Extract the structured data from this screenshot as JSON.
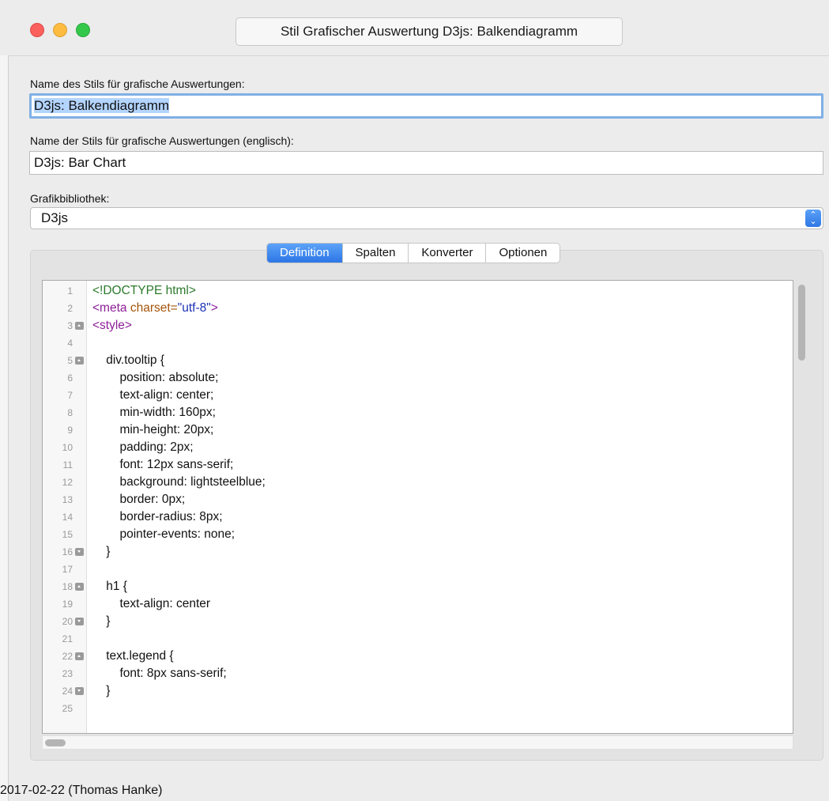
{
  "window": {
    "title": "Stil Grafischer Auswertung D3js: Balkendiagramm"
  },
  "form": {
    "name_label": "Name des Stils für grafische Auswertungen:",
    "name_value": "D3js: Balkendiagramm",
    "name_en_label": "Name der Stils für grafische Auswertungen (englisch):",
    "name_en_value": "D3js: Bar Chart",
    "library_label": "Grafikbibliothek:",
    "library_value": "D3js"
  },
  "tabs": [
    "Definition",
    "Spalten",
    "Konverter",
    "Optionen"
  ],
  "active_tab": "Definition",
  "editor": {
    "lines": [
      {
        "n": "1",
        "fold": "",
        "text": "<!DOCTYPE html>"
      },
      {
        "n": "2",
        "fold": "",
        "text": "<meta charset=\"utf-8\">"
      },
      {
        "n": "3",
        "fold": "open",
        "text": "<style>"
      },
      {
        "n": "4",
        "fold": "",
        "text": ""
      },
      {
        "n": "5",
        "fold": "open",
        "text": "    div.tooltip {"
      },
      {
        "n": "6",
        "fold": "",
        "text": "        position: absolute;"
      },
      {
        "n": "7",
        "fold": "",
        "text": "        text-align: center;"
      },
      {
        "n": "8",
        "fold": "",
        "text": "        min-width: 160px;"
      },
      {
        "n": "9",
        "fold": "",
        "text": "        min-height: 20px;"
      },
      {
        "n": "10",
        "fold": "",
        "text": "        padding: 2px;"
      },
      {
        "n": "11",
        "fold": "",
        "text": "        font: 12px sans-serif;"
      },
      {
        "n": "12",
        "fold": "",
        "text": "        background: lightsteelblue;"
      },
      {
        "n": "13",
        "fold": "",
        "text": "        border: 0px;"
      },
      {
        "n": "14",
        "fold": "",
        "text": "        border-radius: 8px;"
      },
      {
        "n": "15",
        "fold": "",
        "text": "        pointer-events: none;"
      },
      {
        "n": "16",
        "fold": "close",
        "text": "    }"
      },
      {
        "n": "17",
        "fold": "",
        "text": ""
      },
      {
        "n": "18",
        "fold": "open",
        "text": "    h1 {"
      },
      {
        "n": "19",
        "fold": "",
        "text": "        text-align: center"
      },
      {
        "n": "20",
        "fold": "close",
        "text": "    }"
      },
      {
        "n": "21",
        "fold": "",
        "text": ""
      },
      {
        "n": "22",
        "fold": "open",
        "text": "    text.legend {"
      },
      {
        "n": "23",
        "fold": "",
        "text": "        font: 8px sans-serif;"
      },
      {
        "n": "24",
        "fold": "close",
        "text": "    }"
      },
      {
        "n": "25",
        "fold": "",
        "text": ""
      }
    ]
  },
  "footer": {
    "text": "2017-02-22 (Thomas Hanke)"
  }
}
